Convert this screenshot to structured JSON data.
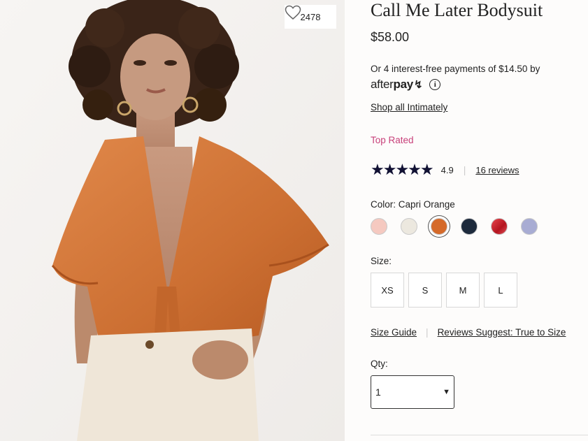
{
  "favorites": {
    "count": "2478",
    "icon": "heart-icon"
  },
  "product": {
    "title": "Call Me Later Bodysuit",
    "price": "$58.00"
  },
  "afterpay": {
    "text": "Or 4 interest-free payments of $14.50 by",
    "logo_regular": "after",
    "logo_bold": "pay",
    "logo_mark": "↯",
    "info_icon": "i"
  },
  "links": {
    "shop_all": "Shop all Intimately"
  },
  "badge": {
    "top_rated": "Top Rated"
  },
  "rating": {
    "stars": "★★★★★",
    "value": "4.9",
    "separator": "|",
    "reviews": "16 reviews"
  },
  "color": {
    "label": "Color: Capri Orange",
    "swatches": [
      {
        "name": "pink",
        "hex": "#f5c9c0"
      },
      {
        "name": "ivory",
        "hex": "#ece8df"
      },
      {
        "name": "capri-orange",
        "hex": "#d56a2a",
        "selected": true
      },
      {
        "name": "navy",
        "hex": "#1d2a3c"
      },
      {
        "name": "red",
        "hex": "#d0232e"
      },
      {
        "name": "lavender",
        "hex": "#a8acd3"
      }
    ]
  },
  "size": {
    "label": "Size:",
    "options": [
      "XS",
      "S",
      "M",
      "L"
    ]
  },
  "guide": {
    "size_guide": "Size Guide",
    "separator": "|",
    "reviews_suggest": "Reviews Suggest: True to Size"
  },
  "qty": {
    "label": "Qty:",
    "value": "1",
    "caret": "▼"
  },
  "colors": {
    "top_rated": "#c8407a",
    "stars": "#111133"
  }
}
